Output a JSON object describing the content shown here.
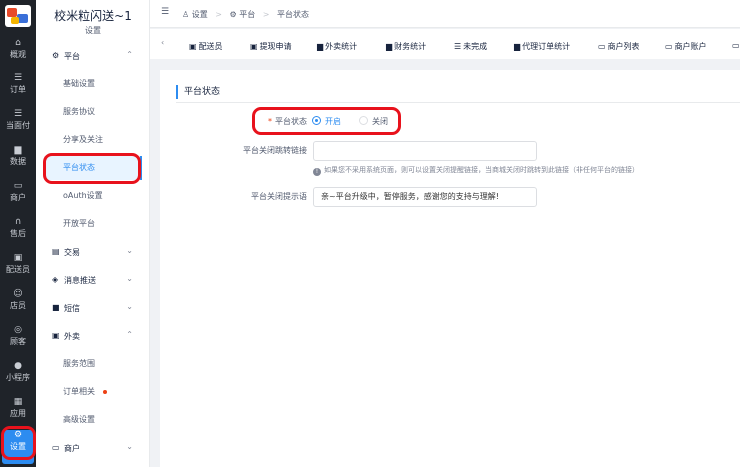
{
  "rail": {
    "items": [
      {
        "label": "概观",
        "icon": "home-icon"
      },
      {
        "label": "订单",
        "icon": "list-icon"
      },
      {
        "label": "当面付",
        "icon": "list-icon"
      },
      {
        "label": "数据",
        "icon": "bar-chart-icon"
      },
      {
        "label": "商户",
        "icon": "store-icon"
      },
      {
        "label": "售后",
        "icon": "headset-icon"
      },
      {
        "label": "配送员",
        "icon": "rider-icon"
      },
      {
        "label": "店员",
        "icon": "staff-icon"
      },
      {
        "label": "顾客",
        "icon": "customer-icon"
      },
      {
        "label": "小程序",
        "icon": "chat-icon"
      },
      {
        "label": "应用",
        "icon": "grid-icon"
      },
      {
        "label": "设置",
        "icon": "settings-icon"
      }
    ]
  },
  "sidebar": {
    "brand": "校米粒闪送~1",
    "section": "设置",
    "groups": {
      "platform": "平台",
      "trade": "交易",
      "push": "消息推送",
      "sms": "短信",
      "takeout": "外卖",
      "merchant": "商户"
    },
    "items": {
      "basic": "基础设置",
      "agreement": "服务协议",
      "share": "分享及关注",
      "status": "平台状态",
      "oauth": "oAuth设置",
      "open": "开放平台",
      "scope": "服务范围",
      "order": "订单相关",
      "advanced": "高级设置"
    }
  },
  "breadcrumb": [
    "设置",
    "平台",
    "平台状态"
  ],
  "tabs": [
    {
      "label": "配送员",
      "icon": "rider-icon"
    },
    {
      "label": "提现申请",
      "icon": "withdraw-icon"
    },
    {
      "label": "外卖统计",
      "icon": "bar-chart-icon"
    },
    {
      "label": "财务统计",
      "icon": "bar-chart-icon"
    },
    {
      "label": "未完成",
      "icon": "list-icon"
    },
    {
      "label": "代理订单统计",
      "icon": "bar-chart-icon"
    },
    {
      "label": "商户列表",
      "icon": "store-icon"
    },
    {
      "label": "商户账户",
      "icon": "store-icon"
    }
  ],
  "form": {
    "title": "平台状态",
    "status_label": "平台状态",
    "status_required_mark": "*",
    "status_on": "开启",
    "status_off": "关闭",
    "selected": "开启",
    "redirect_label": "平台关闭跳转链接",
    "redirect_value": "",
    "redirect_hint": "如果您不采用系统页面，则可以设置关闭提醒链接，当商城关闭时跳转到此链接（非任何平台的链接）",
    "notice_label": "平台关闭提示语",
    "notice_value": "亲~平台升级中，暂停服务，感谢您的支持与理解!"
  },
  "colors": {
    "accent": "#2d8cf0",
    "rail_bg": "#1f2329",
    "highlight_ring": "#e8121c",
    "badge_dot": "#ed4014"
  }
}
